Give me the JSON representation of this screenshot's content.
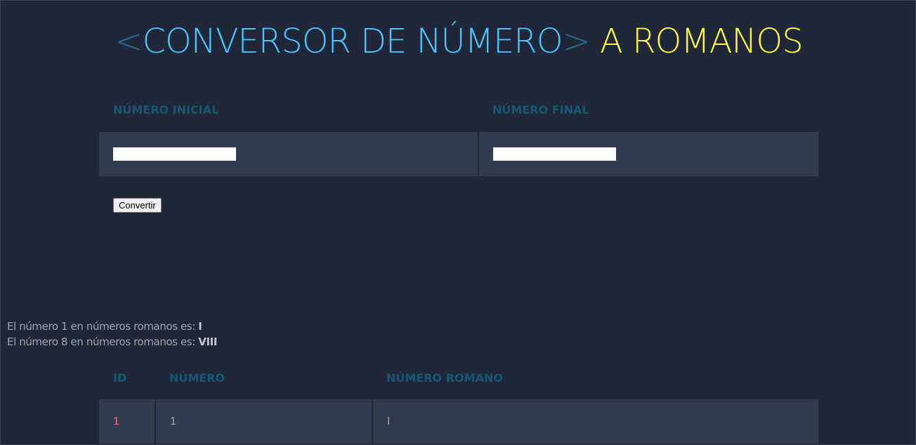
{
  "header": {
    "bracket_open": "<",
    "title_blue": "CONVERSOR DE NÚMERO",
    "bracket_close": ">",
    "title_yellow": "A ROMANOS"
  },
  "form": {
    "headers": [
      "NÚMERO INICIAL",
      "NÚMERO FINAL"
    ],
    "initial_value": "",
    "final_value": "",
    "submit_label": "Convertir"
  },
  "results": [
    {
      "prefix": "El número 1 en números romanos es: ",
      "roman": "I"
    },
    {
      "prefix": "El número 8 en números romanos es: ",
      "roman": "VIII"
    }
  ],
  "table": {
    "headers": [
      "ID",
      "NÚMERO",
      "NÚMERO ROMANO"
    ],
    "rows": [
      {
        "id": "1",
        "number": "1",
        "roman": "I"
      }
    ]
  },
  "colors": {
    "background": "#1f2739",
    "row_background": "#323c50",
    "header_text": "#185875",
    "title_blue": "#4dc3fa",
    "title_yellow": "#fff842",
    "id_accent": "#fb667a"
  }
}
